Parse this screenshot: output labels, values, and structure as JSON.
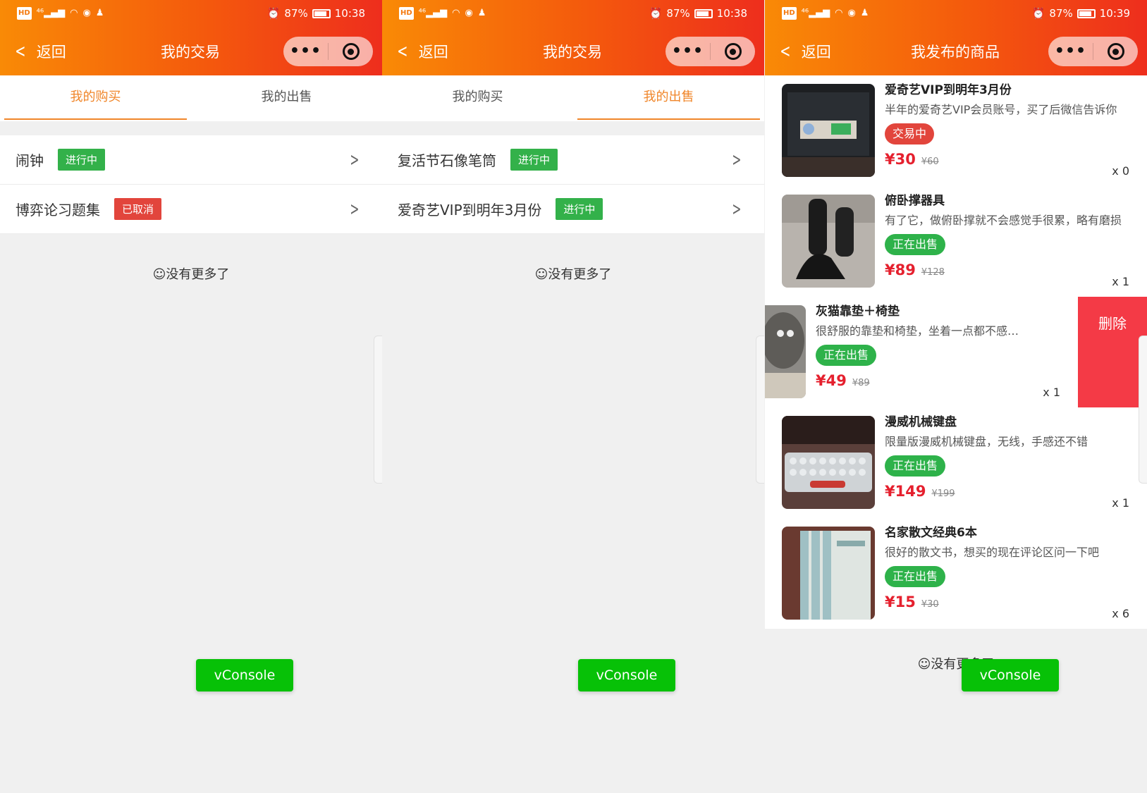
{
  "status_bar_left": [
    "HD",
    "46",
    "signal",
    "wifi",
    "eye",
    "qq"
  ],
  "screens": [
    {
      "status": {
        "battery": "87%",
        "time": "10:38"
      },
      "nav": {
        "back_label": "返回",
        "title": "我的交易"
      },
      "tabs": [
        {
          "label": "我的购买",
          "active": true
        },
        {
          "label": "我的出售",
          "active": false
        }
      ],
      "rows": [
        {
          "title": "闹钟",
          "badge": "进行中",
          "badge_color": "green"
        },
        {
          "title": "博弈论习题集",
          "badge": "已取消",
          "badge_color": "red"
        }
      ],
      "no_more": "☺没有更多了",
      "vconsole": "vConsole"
    },
    {
      "status": {
        "battery": "87%",
        "time": "10:38"
      },
      "nav": {
        "back_label": "返回",
        "title": "我的交易"
      },
      "tabs": [
        {
          "label": "我的购买",
          "active": false
        },
        {
          "label": "我的出售",
          "active": true
        }
      ],
      "rows": [
        {
          "title": "复活节石像笔筒",
          "badge": "进行中",
          "badge_color": "green"
        },
        {
          "title": "爱奇艺VIP到明年3月份",
          "badge": "进行中",
          "badge_color": "green"
        }
      ],
      "no_more": "☺没有更多了",
      "vconsole": "vConsole"
    },
    {
      "status": {
        "battery": "87%",
        "time": "10:39"
      },
      "nav": {
        "back_label": "返回",
        "title": "我发布的商品"
      },
      "goods": [
        {
          "title": "爱奇艺VIP到明年3月份",
          "desc": "半年的爱奇艺VIP会员账号，买了后微信告诉你",
          "status": "交易中",
          "status_color": "red",
          "price": "¥30",
          "orig": "¥60",
          "qty": "x 0"
        },
        {
          "title": "俯卧撑器具",
          "desc": "有了它，做俯卧撑就不会感觉手很累，略有磨损",
          "status": "正在出售",
          "status_color": "green",
          "price": "¥89",
          "orig": "¥128",
          "qty": "x 1"
        },
        {
          "title": "灰猫靠垫＋椅垫",
          "desc": "很舒服的靠垫和椅垫，坐着一点都不感觉累",
          "status": "正在出售",
          "status_color": "green",
          "price": "¥49",
          "orig": "¥89",
          "qty": "x 1",
          "delete_label": "删除"
        },
        {
          "title": "漫威机械键盘",
          "desc": "限量版漫威机械键盘，无线，手感还不错",
          "status": "正在出售",
          "status_color": "green",
          "price": "¥149",
          "orig": "¥199",
          "qty": "x 1"
        },
        {
          "title": "名家散文经典6本",
          "desc": "很好的散文书，想买的现在评论区问一下吧",
          "status": "正在出售",
          "status_color": "green",
          "price": "¥15",
          "orig": "¥30",
          "qty": "x 6"
        }
      ],
      "no_more": "☺没有更多了",
      "vconsole": "vConsole"
    }
  ],
  "colors": {
    "header_start": "#f98a06",
    "header_end": "#ee2e1d",
    "accent": "#f0862a",
    "green": "#33b14a",
    "red": "#e2453c",
    "price": "#e5202e",
    "vconsole": "#07c107"
  }
}
